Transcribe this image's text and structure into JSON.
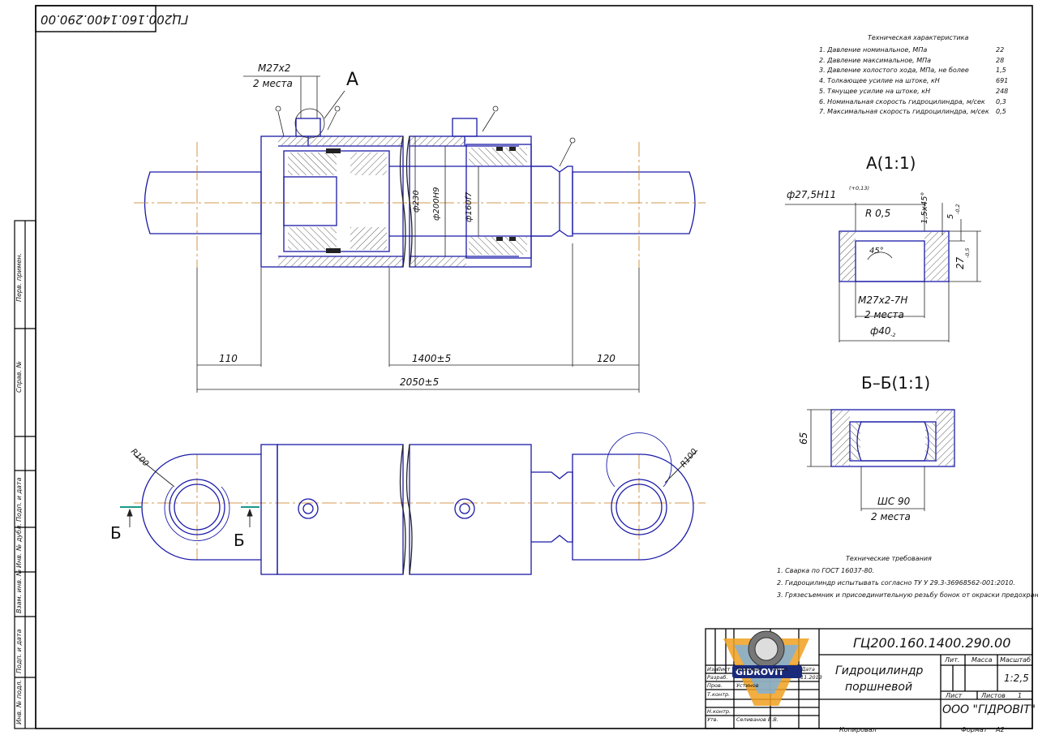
{
  "stamp_top": "ГЦ200.160.1400.290.00",
  "tech_char": {
    "title": "Техническая характеристика",
    "rows": [
      {
        "label": "1. Давление номинальное, МПа",
        "value": "22"
      },
      {
        "label": "2. Давление максимальное, МПа",
        "value": "28"
      },
      {
        "label": "3. Давление холостого хода, МПа, не более",
        "value": "1,5"
      },
      {
        "label": "4. Толкающее усилие на штоке, кН",
        "value": "691"
      },
      {
        "label": "5. Тянущее усилие на штоке, кН",
        "value": "248"
      },
      {
        "label": "6. Номинальная скорость гидроцилиндра, м/сек",
        "value": "0,3"
      },
      {
        "label": "7. Максимальная скорость гидроцилиндра, м/сек",
        "value": "0,5"
      }
    ]
  },
  "tech_req": {
    "title": "Технические требования",
    "rows": [
      "1. Сварка по ГОСТ 16037-80.",
      "2. Гидроцилиндр испытывать согласно ТУ У 29.3-36968562-001:2010.",
      "3. Грязесъемник и присоединительную резьбу бонок от окраски предохранить."
    ]
  },
  "dims": {
    "thread_top": "М27х2",
    "thread_bottom": "2 места",
    "view_a": "А",
    "d230": "ф230",
    "d200": "ф200Н9",
    "d160": "ф160f7",
    "d110": "110",
    "d1400": "1400±5",
    "d120": "120",
    "d2050": "2050±5",
    "r100_left": "R100",
    "r100_right": "R100",
    "section_b_left": "Б",
    "section_b_right": "Б"
  },
  "detail_a": {
    "title": "А(1:1)",
    "d275": "ф27,5Н11",
    "tol": "(+0,13)",
    "r05": "R 0,5",
    "chamfer": "1,5х45°",
    "dim5": "5",
    "dim5_tol": "-0,2",
    "dim27": "27",
    "dim27_tol": "-0,5",
    "angle45": "45°",
    "thread": "М27х2-7Н",
    "places": "2 места",
    "d40": "ф40",
    "d40_tol": "-2"
  },
  "detail_b": {
    "title": "Б–Б(1:1)",
    "dim65": "65",
    "bearing": "ШС 90",
    "places": "2 места"
  },
  "side_labels": [
    "Перв. примен.",
    "Справ. №",
    "Подп. и дата",
    "Инв. № дубл.",
    "Взам. инв. №",
    "Подп. и дата",
    "Инв. № подл."
  ],
  "title_block": {
    "doc_number": "ГЦ200.160.1400.290.00",
    "name_line1": "Гидроцилиндр",
    "name_line2": "поршневой",
    "company": "ООО \"ГІДРОВІТ\"",
    "logo_text": "GIDROVIT",
    "lit_label": "Лит.",
    "mass_label": "Масса",
    "scale_label": "Масштаб",
    "scale_value": "1:2,5",
    "sheet_label": "Лист",
    "sheets_label": "Листов",
    "sheets_value": "1",
    "izm": "Изм.",
    "list": "Лист",
    "ndoc": "№ докум.",
    "podp": "Подп.",
    "data": "Дата",
    "razrab": "Разраб.",
    "prov": "Пров.",
    "tkontr": "Т.контр.",
    "nkontr": "Н.контр.",
    "utv": "Утв.",
    "razrab_name": "Устинов",
    "utv_name": "Селиванов В.В.",
    "date_val": "11.2013",
    "kopiroval": "Копировал",
    "format": "Формат",
    "format_value": "А2"
  }
}
